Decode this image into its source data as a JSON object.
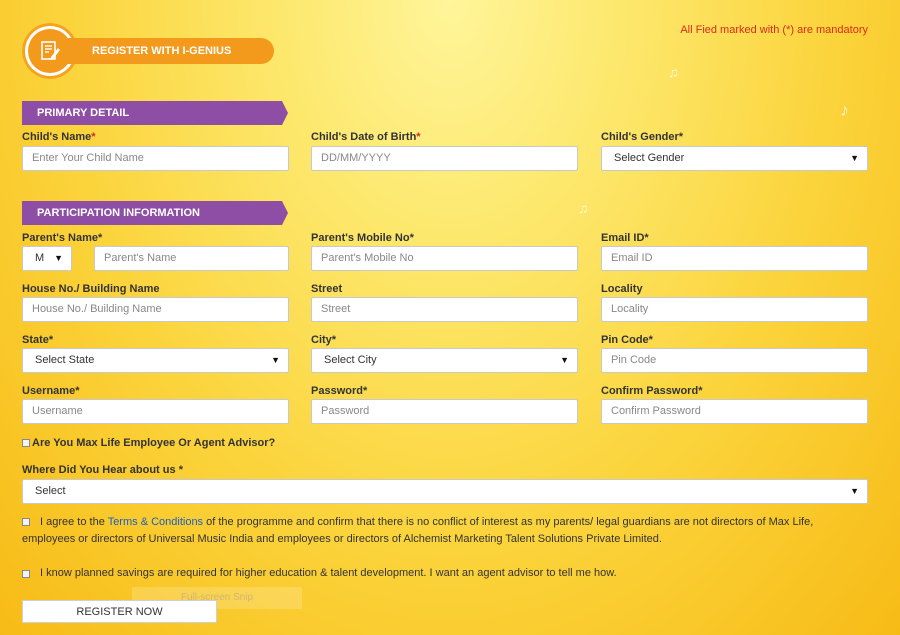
{
  "header": {
    "title": "REGISTER WITH I-GENIUS",
    "mandatory_note": "All Fied marked with (*) are mandatory",
    "icon": "form-edit-icon"
  },
  "primary": {
    "section_title": "PRIMARY DETAIL",
    "child_name_label": "Child's Name",
    "child_name_placeholder": "Enter Your Child Name",
    "dob_label": "Child's Date of Birth",
    "dob_placeholder": "DD/MM/YYYY",
    "gender_label": "Child's Gender",
    "gender_selected": "Select Gender"
  },
  "participation": {
    "section_title": "PARTICIPATION INFORMATION",
    "parent_name_label": "Parent's Name",
    "title_selected": "M",
    "parent_name_placeholder": "Parent's Name",
    "mobile_label": "Parent's Mobile No",
    "mobile_placeholder": "Parent's Mobile No",
    "email_label": "Email ID",
    "email_placeholder": "Email ID",
    "house_label": "House No./ Building Name",
    "house_placeholder": "House No./ Building Name",
    "street_label": "Street",
    "street_placeholder": "Street",
    "locality_label": "Locality",
    "locality_placeholder": "Locality",
    "state_label": "State",
    "state_selected": "Select State",
    "city_label": "City",
    "city_selected": "Select City",
    "pincode_label": "Pin Code",
    "pincode_placeholder": "Pin Code",
    "username_label": "Username",
    "username_placeholder": "Username",
    "password_label": "Password",
    "password_placeholder": "Password",
    "confirm_label": "Confirm Password",
    "confirm_placeholder": "Confirm Password"
  },
  "required_mark": "*",
  "employee_question": "Are You Max Life Employee Or Agent Advisor?",
  "hear_label": "Where Did You Hear about us",
  "hear_selected": "Select",
  "terms": {
    "prefix": "I agree to the ",
    "link": "Terms & Conditions",
    "suffix": " of the programme and confirm that there is no conflict of interest as my parents/ legal guardians are not directors of Max Life, employees or directors of Universal Music India and employees or directors of Alchemist Marketing Talent Solutions Private Limited."
  },
  "savings_note": "I know planned savings are required for higher education & talent development. I want an agent advisor to tell me how.",
  "register_button": "REGISTER NOW",
  "snip_ghost": "Full-screen Snip",
  "caret_glyph": "▼",
  "colors": {
    "section_purple": "#8f4ea5",
    "header_orange": "#f39a1c",
    "mandatory_red": "#e0281e",
    "link_blue": "#1a5fc4"
  }
}
